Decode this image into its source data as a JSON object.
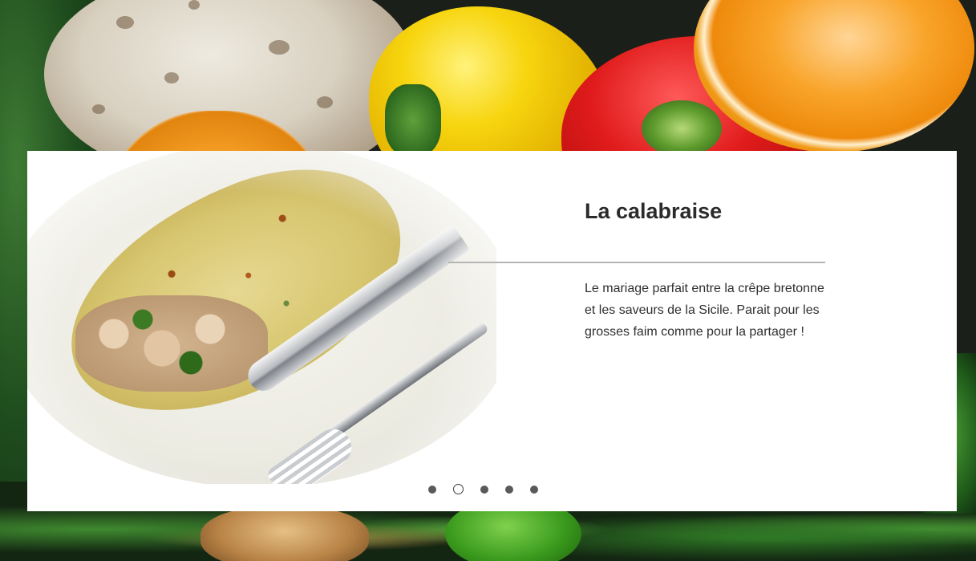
{
  "slide": {
    "title": "La calabraise",
    "description": "Le mariage parfait entre la crêpe bretonne et les saveurs de la Sicile. Parait pour les grosses faim comme pour la partager !",
    "image_icon": "crepe-dish-image"
  },
  "carousel": {
    "dots": [
      {
        "active": false
      },
      {
        "active": true
      },
      {
        "active": false
      },
      {
        "active": false
      },
      {
        "active": false
      }
    ],
    "current_index": 2,
    "total": 5
  },
  "colors": {
    "card_background": "#ffffff",
    "title_text": "#2b2b2b",
    "body_text": "#2f2f2f",
    "divider": "#b5b5b5",
    "dot_inactive": "#5a5a5a"
  }
}
